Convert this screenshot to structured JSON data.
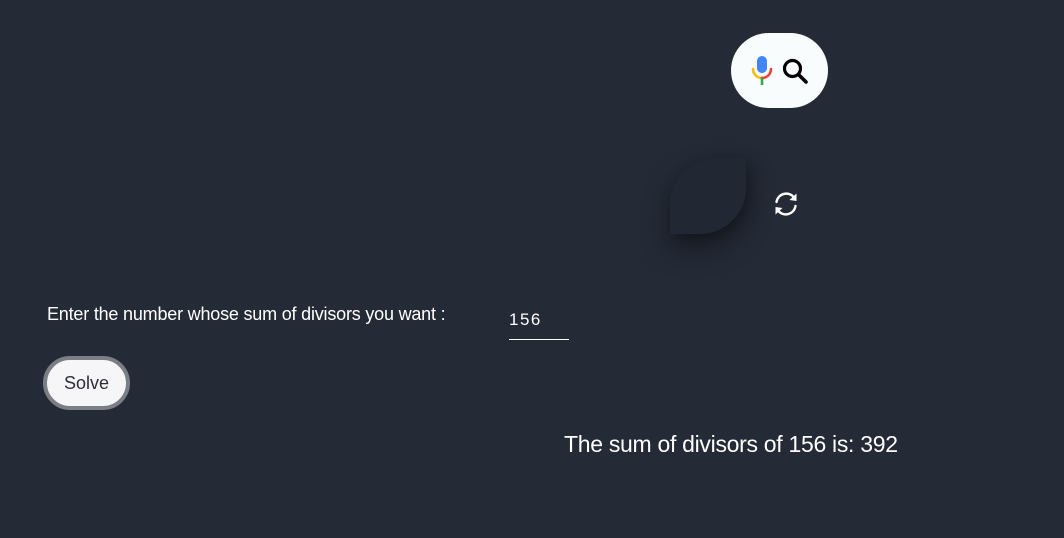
{
  "toolbar": {
    "mic_icon": "microphone-icon",
    "search_icon": "search-icon",
    "refresh_icon": "refresh-icon"
  },
  "form": {
    "label": "Enter the number whose sum of divisors you want :",
    "input_value": "156",
    "solve_label": "Solve"
  },
  "result": {
    "text": "The sum of divisors of 156 is: 392"
  },
  "colors": {
    "background": "#242a36",
    "pill": "#f8fcfd",
    "button_border": "#7b7e84"
  }
}
